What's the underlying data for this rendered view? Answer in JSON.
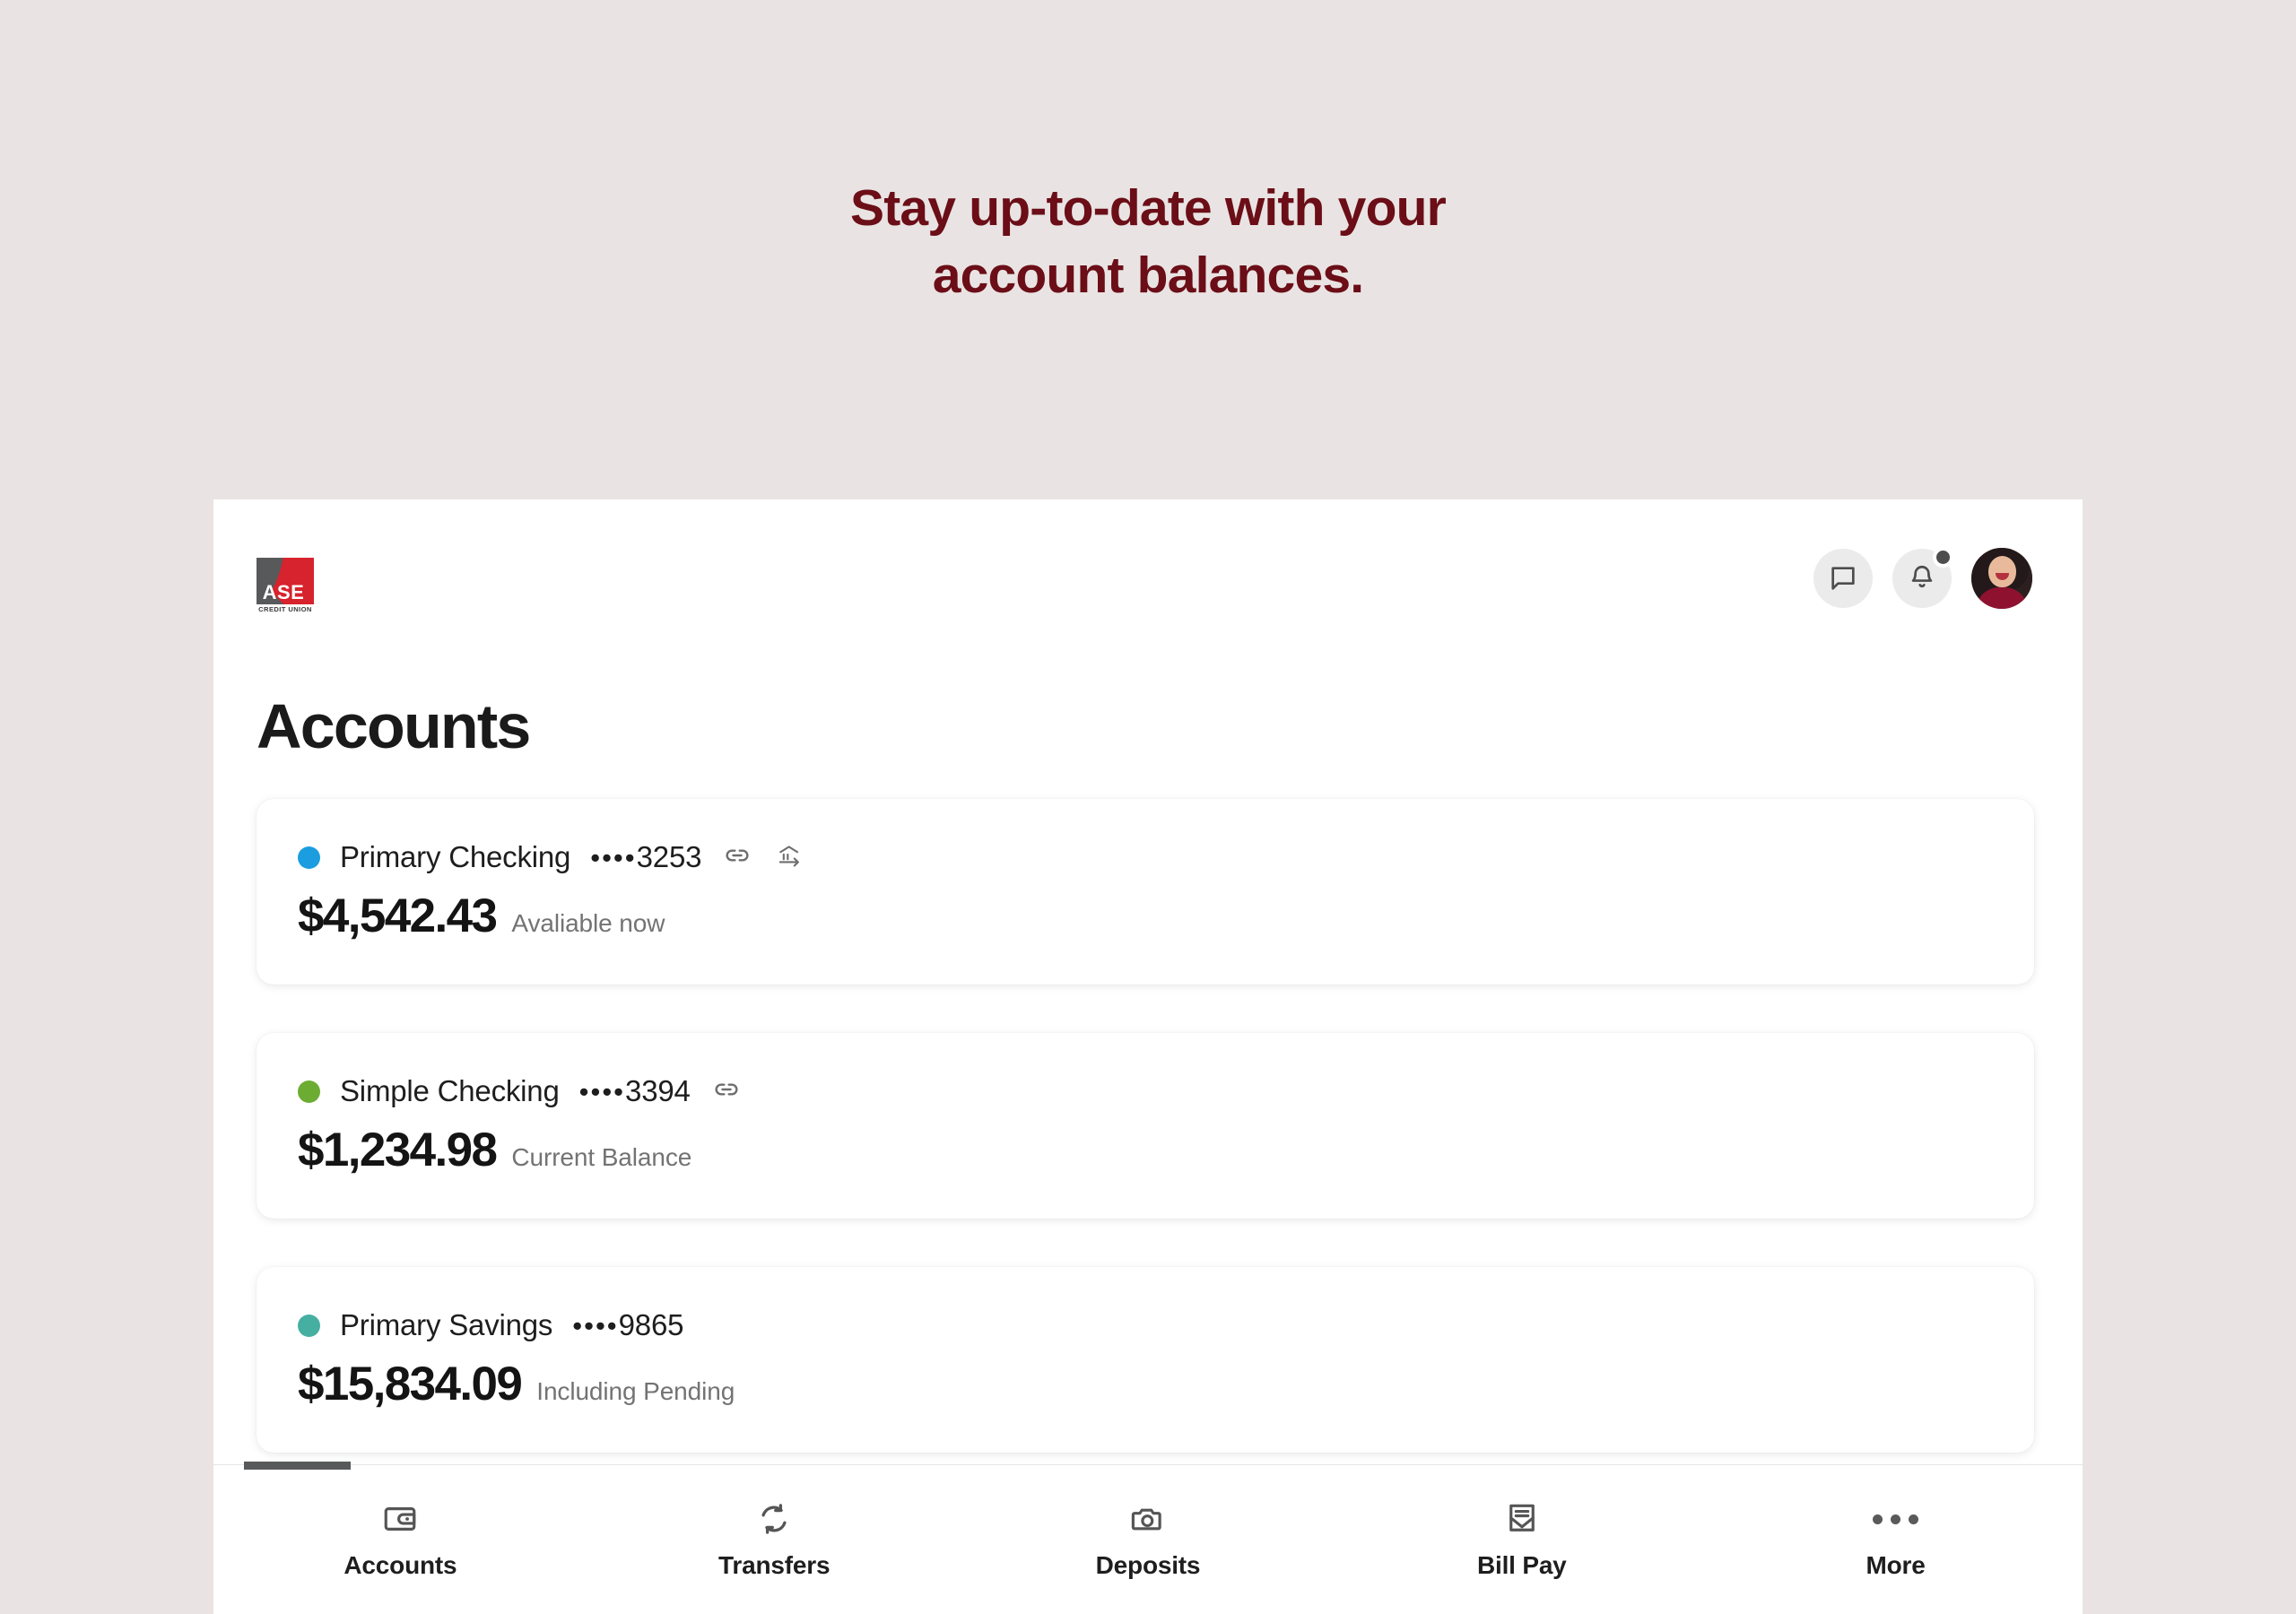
{
  "promo": {
    "line1": "Stay up-to-date with your",
    "line2": "account balances.",
    "color": "#6B0E17"
  },
  "app": {
    "brand": {
      "mark_text": "ASE",
      "sub_text": "CREDIT UNION",
      "red": "#D7232E",
      "gray": "#58595B"
    },
    "header": {
      "messages_icon": "chat-bubble-icon",
      "notifications_icon": "bell-icon",
      "notification_badge": true,
      "avatar_icon": "user-avatar"
    },
    "page_title": "Accounts",
    "accounts": [
      {
        "name": "Primary Checking",
        "mask_dots": "••••",
        "mask_digits": "3253",
        "dot_color": "#1B9DE0",
        "balance": "$4,542.43",
        "balance_label": "Avaliable now",
        "icons": [
          "link-icon",
          "bank-transfer-icon"
        ]
      },
      {
        "name": "Simple Checking",
        "mask_dots": "••••",
        "mask_digits": "3394",
        "dot_color": "#6DAC33",
        "balance": "$1,234.98",
        "balance_label": "Current Balance",
        "icons": [
          "link-icon"
        ]
      },
      {
        "name": "Primary Savings",
        "mask_dots": "••••",
        "mask_digits": "9865",
        "dot_color": "#45AFA2",
        "balance": "$15,834.09",
        "balance_label": "Including Pending",
        "icons": []
      }
    ],
    "bottom_nav": {
      "active": "Accounts",
      "items": [
        {
          "label": "Accounts",
          "icon": "wallet-icon"
        },
        {
          "label": "Transfers",
          "icon": "sync-arrows-icon"
        },
        {
          "label": "Deposits",
          "icon": "camera-icon"
        },
        {
          "label": "Bill Pay",
          "icon": "envelope-icon"
        },
        {
          "label": "More",
          "icon": "ellipsis-icon"
        }
      ]
    }
  }
}
